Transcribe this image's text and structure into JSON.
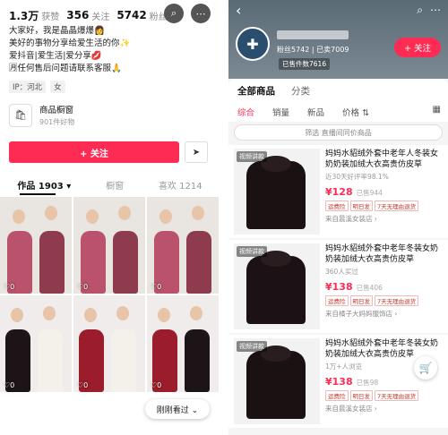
{
  "left": {
    "stats": [
      {
        "num": "1.3万",
        "label": "获赞"
      },
      {
        "num": "356",
        "label": "关注"
      },
      {
        "num": "5742",
        "label": "粉丝"
      }
    ],
    "search_icon": "search-icon",
    "more_icon": "more-icon",
    "bio": [
      "大家好，我是晶晶爆爆👩",
      "美好的事物分享给爱生活的你✨",
      "爱抖音|爱生活|爱分享💋",
      "🈷任何售后问题请联系客服🙏"
    ],
    "tags": [
      "IP：河北",
      "女"
    ],
    "shop": {
      "title": "商品橱窗",
      "sub": "901件好物"
    },
    "follow_label": "+ 关注",
    "tabs": [
      "作品 1903 ▾",
      "橱窗",
      "喜欢 1214"
    ],
    "likes": [
      "♡0",
      "♡0",
      "♡0",
      "♡0",
      "♡0",
      "♡0"
    ],
    "skip_label": "刚刚看过 ⌄"
  },
  "right": {
    "shop_stats": "粉丝5742 | 已卖7009",
    "shop_badge": "已售件数7616",
    "follow_label": "+ 关注",
    "tabs": [
      "全部商品",
      "分类"
    ],
    "sorts": [
      "综合",
      "销量",
      "新品",
      "价格 ⇅"
    ],
    "filter_label": "筛选 直播间同价商品",
    "products": [
      {
        "video": "视频讲款",
        "title": "妈妈水貂绒外套中老年人冬装女奶奶装加绒大衣高贵仿皮草",
        "sub": "近30天好评率98.1%",
        "price": "¥128",
        "sold": "已售944",
        "badges": [
          "运费险",
          "明日发",
          "7天无理由退货"
        ],
        "from": "来自晨溪女装店 ›"
      },
      {
        "video": "视频讲款",
        "title": "妈妈水貂绒外套中老年冬装女奶奶装加绒大衣高贵仿皮草",
        "sub": "360人买过",
        "price": "¥138",
        "sold": "已售406",
        "badges": [
          "运费险",
          "明日发",
          "7天无理由退货"
        ],
        "from": "来自橘子大妈妈服饰店 ›"
      },
      {
        "video": "视频讲款",
        "title": "妈妈水貂绒外套中老年冬装女奶奶装加绒大衣高贵仿皮草",
        "sub": "1万+人浏览",
        "price": "¥138",
        "sold": "已售98",
        "badges": [
          "运费险",
          "明日发",
          "7天无理由退货"
        ],
        "from": "来自晨溪女装店 ›"
      }
    ]
  },
  "colors": {
    "accent": "#fe2c55",
    "coat": "#1a1113"
  }
}
